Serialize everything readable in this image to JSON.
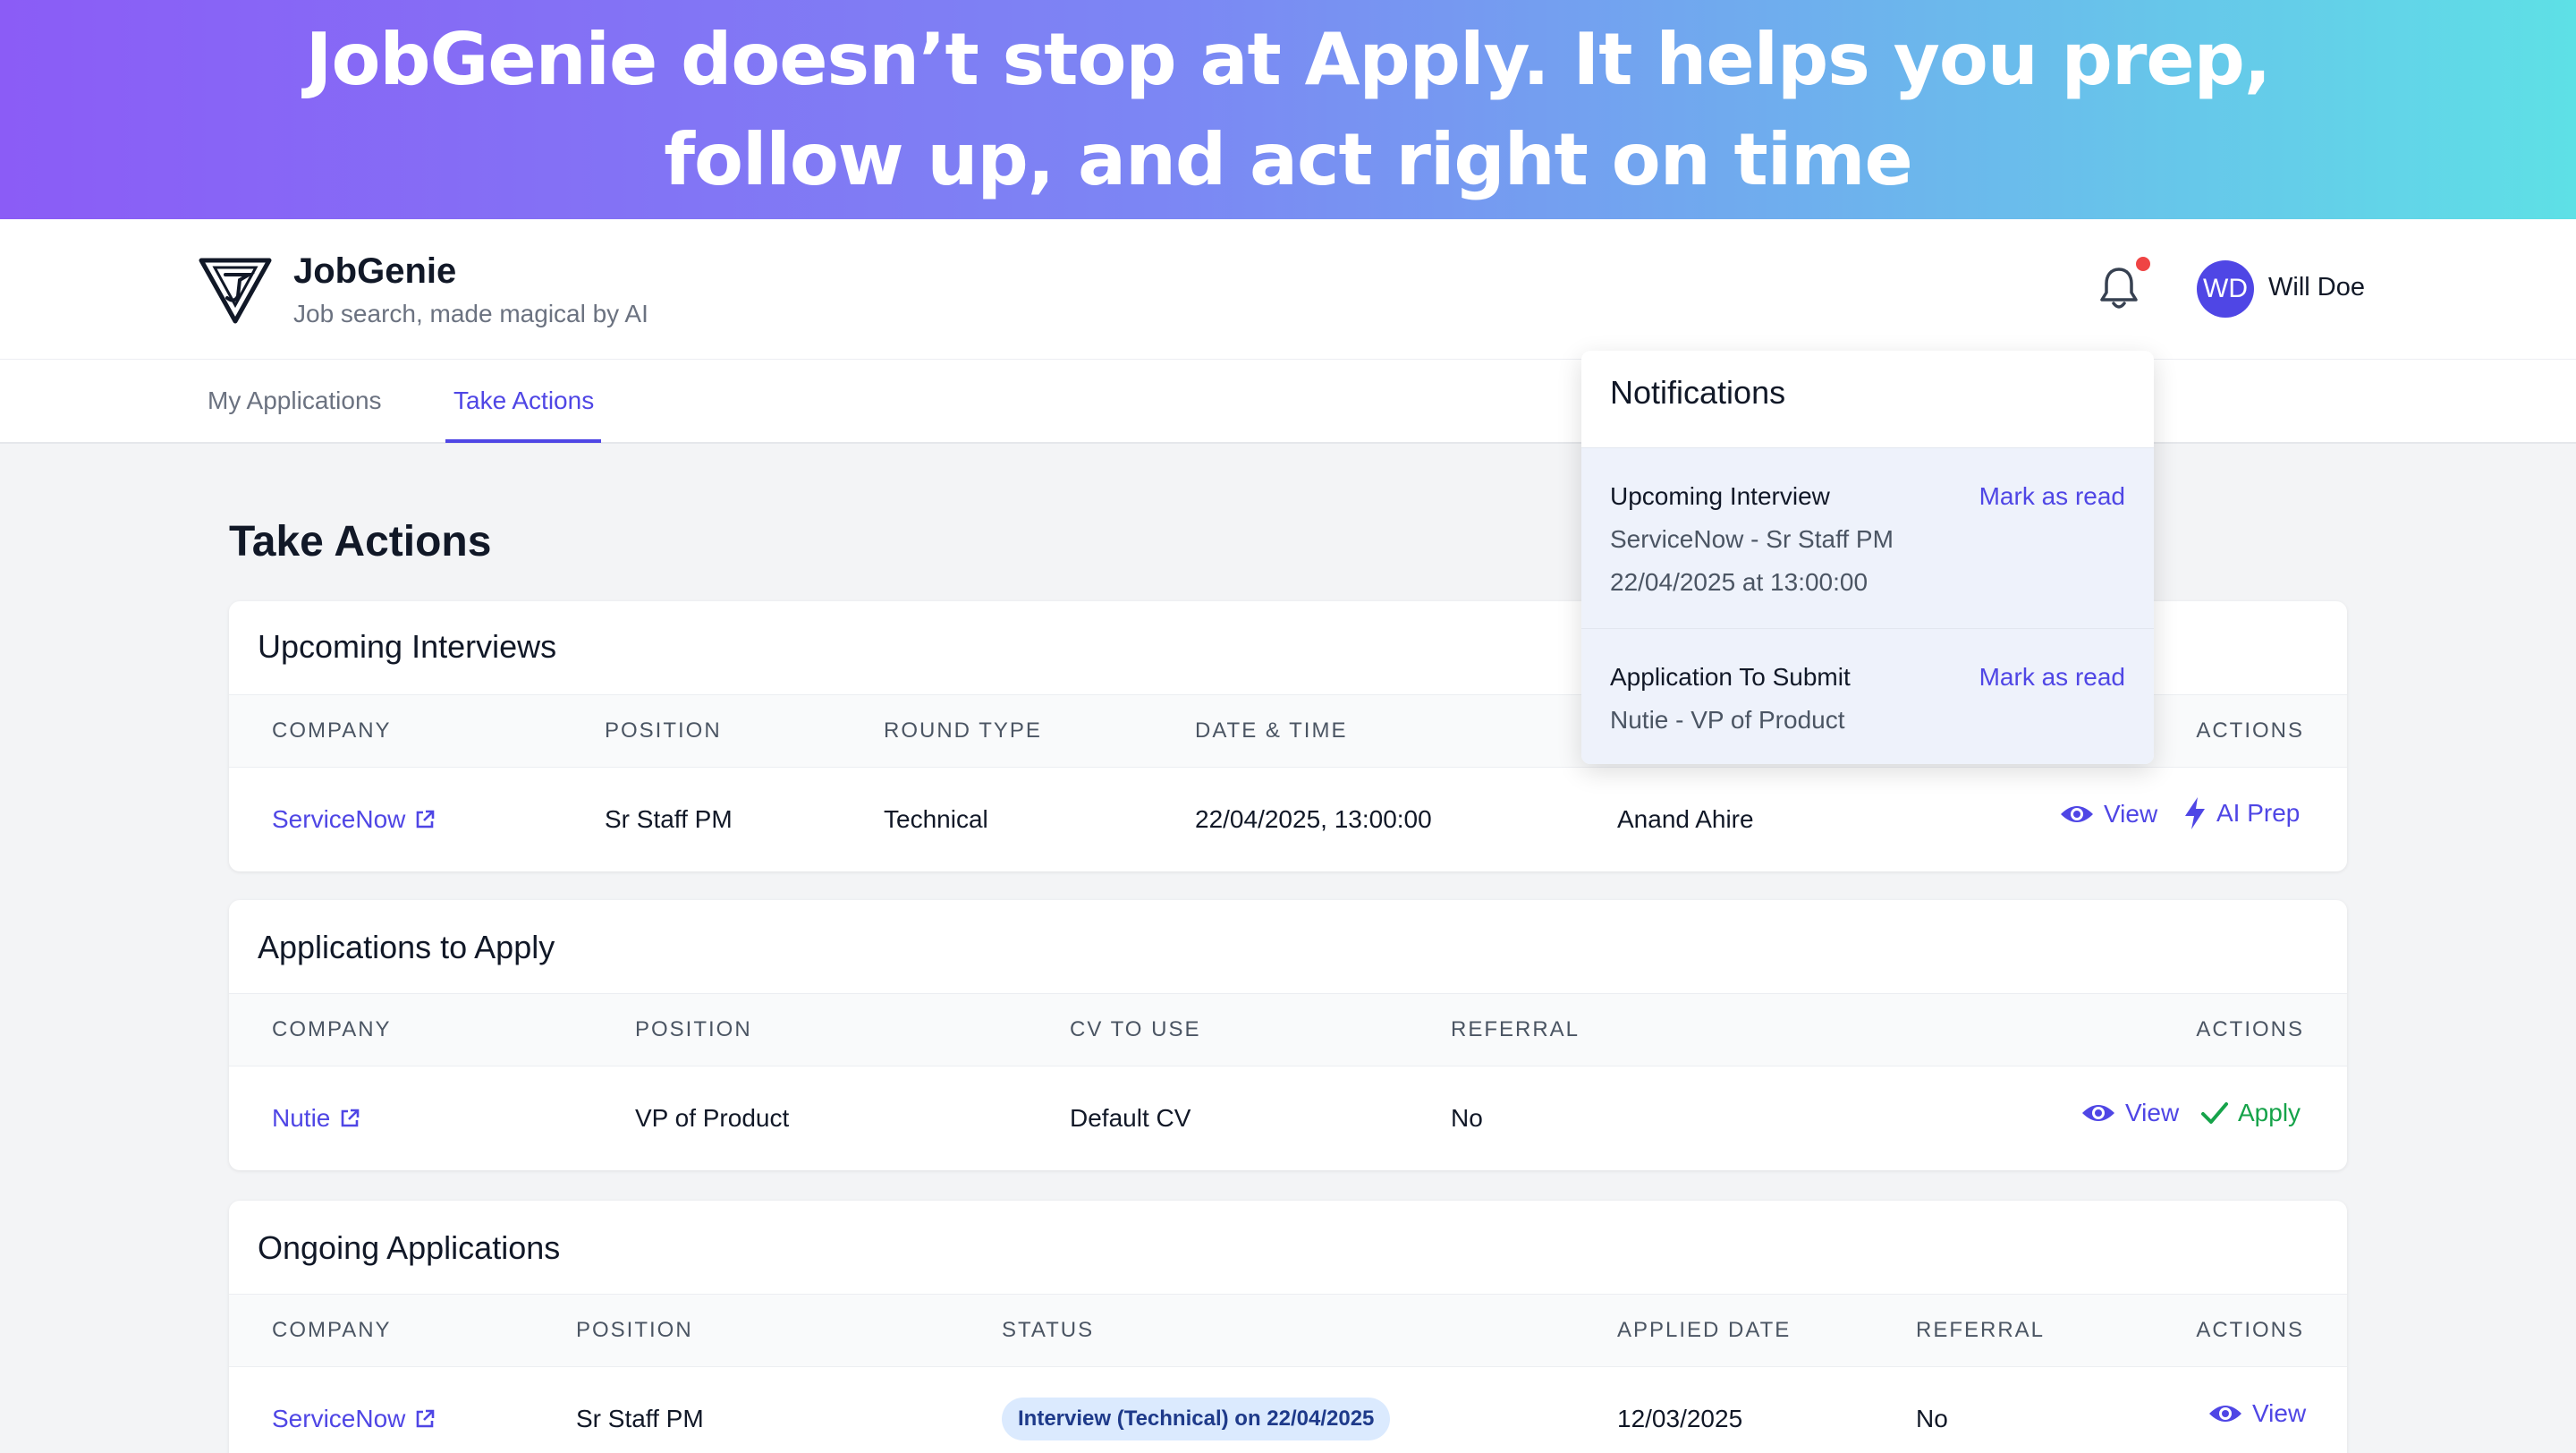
{
  "banner": {
    "headline_line1": "JobGenie doesn’t stop at Apply. It helps you prep,",
    "headline_line2": "follow up, and act right on time"
  },
  "header": {
    "brand_name": "JobGenie",
    "tagline": "Job search, made magical by AI",
    "user_initials": "WD",
    "user_name": "Will Doe"
  },
  "tabs": [
    {
      "label": "My Applications"
    },
    {
      "label": "Take Actions"
    }
  ],
  "page_title": "Take Actions",
  "upcoming": {
    "title": "Upcoming Interviews",
    "columns": [
      "COMPANY",
      "POSITION",
      "ROUND TYPE",
      "DATE & TIME",
      "ACTIONS"
    ],
    "rows": [
      {
        "company": "ServiceNow",
        "position": "Sr Staff PM",
        "round": "Technical",
        "datetime": "22/04/2025, 13:00:00",
        "interviewer": "Anand Ahire"
      }
    ],
    "view_label": "View",
    "aiprep_label": "AI Prep"
  },
  "to_apply": {
    "title": "Applications to Apply",
    "columns": [
      "COMPANY",
      "POSITION",
      "CV TO USE",
      "REFERRAL",
      "ACTIONS"
    ],
    "rows": [
      {
        "company": "Nutie",
        "position": "VP of Product",
        "cv": "Default CV",
        "referral": "No"
      }
    ],
    "view_label": "View",
    "apply_label": "Apply"
  },
  "ongoing": {
    "title": "Ongoing Applications",
    "columns": [
      "COMPANY",
      "POSITION",
      "STATUS",
      "APPLIED DATE",
      "REFERRAL",
      "ACTIONS"
    ],
    "rows": [
      {
        "company": "ServiceNow",
        "position": "Sr Staff PM",
        "status": "Interview (Technical) on 22/04/2025",
        "applied": "12/03/2025",
        "referral": "No"
      }
    ],
    "view_label": "View"
  },
  "notifications": {
    "title": "Notifications",
    "items": [
      {
        "title": "Upcoming Interview",
        "line1": "ServiceNow - Sr Staff PM",
        "line2": "22/04/2025 at 13:00:00",
        "action": "Mark as read"
      },
      {
        "title": "Application To Submit",
        "line1": "Nutie - VP of Product",
        "action": "Mark as read"
      }
    ]
  },
  "colors": {
    "accent": "#4f46e5",
    "success": "#16a34a",
    "alert_dot": "#ef4444",
    "badge_bg": "#dbeafe"
  },
  "icons": [
    "bell-icon",
    "external-link-icon",
    "eye-icon",
    "lightning-icon",
    "check-icon",
    "logo-icon"
  ]
}
